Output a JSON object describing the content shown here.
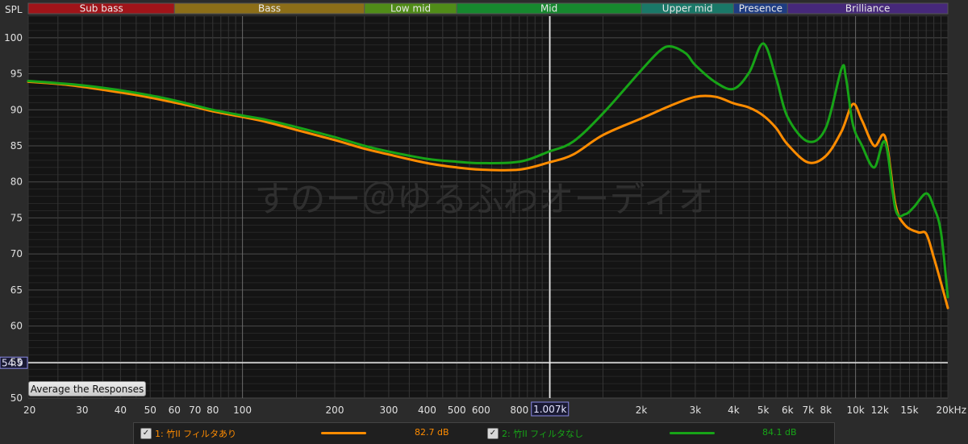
{
  "chart_data": {
    "type": "line",
    "ylabel": "SPL",
    "ylim": [
      50,
      103
    ],
    "xlim": [
      20,
      20000
    ],
    "xscale": "log",
    "grid": true,
    "yticks": [
      50,
      55,
      60,
      65,
      70,
      75,
      80,
      85,
      90,
      95,
      100
    ],
    "xticks": [
      {
        "v": 20,
        "label": "20"
      },
      {
        "v": 30,
        "label": "30"
      },
      {
        "v": 40,
        "label": "40"
      },
      {
        "v": 50,
        "label": "50"
      },
      {
        "v": 60,
        "label": "60"
      },
      {
        "v": 70,
        "label": "70"
      },
      {
        "v": 80,
        "label": "80"
      },
      {
        "v": 100,
        "label": "100"
      },
      {
        "v": 200,
        "label": "200"
      },
      {
        "v": 300,
        "label": "300"
      },
      {
        "v": 400,
        "label": "400"
      },
      {
        "v": 500,
        "label": "500"
      },
      {
        "v": 600,
        "label": "600"
      },
      {
        "v": 800,
        "label": "800"
      },
      {
        "v": 2000,
        "label": "2k"
      },
      {
        "v": 3000,
        "label": "3k"
      },
      {
        "v": 4000,
        "label": "4k"
      },
      {
        "v": 5000,
        "label": "5k"
      },
      {
        "v": 6000,
        "label": "6k"
      },
      {
        "v": 7000,
        "label": "7k"
      },
      {
        "v": 8000,
        "label": "8k"
      },
      {
        "v": 10000,
        "label": "10k"
      },
      {
        "v": 12000,
        "label": "12k"
      },
      {
        "v": 15000,
        "label": "15k"
      },
      {
        "v": 20000,
        "label": "20kHz"
      }
    ],
    "bands": [
      {
        "name": "Sub bass",
        "from": 20,
        "to": 60,
        "color": "#a01419"
      },
      {
        "name": "Bass",
        "from": 60,
        "to": 250,
        "color": "#8c6e18"
      },
      {
        "name": "Low mid",
        "from": 250,
        "to": 500,
        "color": "#508c18"
      },
      {
        "name": "Mid",
        "from": 500,
        "to": 2000,
        "color": "#16882e"
      },
      {
        "name": "Upper mid",
        "from": 2000,
        "to": 4000,
        "color": "#1a7868"
      },
      {
        "name": "Presence",
        "from": 4000,
        "to": 6000,
        "color": "#1e3c82"
      },
      {
        "name": "Brilliance",
        "from": 6000,
        "to": 20000,
        "color": "#46287a"
      }
    ],
    "cursor": {
      "x": 1007,
      "x_label": "1.007k",
      "y": 54.9,
      "y_label": "54.9"
    },
    "watermark": "すのー＠ゆるふわオーディオ",
    "series": [
      {
        "name": "1: 竹II フィルタあり",
        "color": "#ff8c00",
        "value_label": "82.7 dB",
        "x": [
          20,
          25,
          30,
          40,
          50,
          60,
          70,
          80,
          100,
          120,
          150,
          200,
          250,
          300,
          400,
          500,
          600,
          800,
          1000,
          1200,
          1500,
          2000,
          2500,
          3000,
          3500,
          4000,
          4500,
          5000,
          5500,
          6000,
          7000,
          8000,
          9000,
          9800,
          10500,
          11500,
          12500,
          13500,
          14500,
          16000,
          17000,
          18000,
          19000,
          20000
        ],
        "y": [
          93.9,
          93.6,
          93.2,
          92.4,
          91.7,
          91.0,
          90.4,
          89.8,
          89.0,
          88.3,
          87.2,
          85.8,
          84.6,
          83.8,
          82.6,
          82.0,
          81.7,
          81.7,
          82.7,
          83.8,
          86.5,
          88.8,
          90.6,
          91.8,
          91.8,
          90.9,
          90.3,
          89.2,
          87.5,
          85.2,
          82.7,
          83.6,
          87.0,
          90.8,
          88.5,
          85.0,
          86.2,
          76.8,
          74.0,
          73.0,
          72.8,
          69.5,
          66.0,
          62.5
        ]
      },
      {
        "name": "2: 竹II フィルタなし",
        "color": "#17a417",
        "value_label": "84.1 dB",
        "x": [
          20,
          25,
          30,
          40,
          50,
          60,
          70,
          80,
          100,
          120,
          150,
          200,
          250,
          300,
          400,
          500,
          600,
          800,
          1000,
          1200,
          1500,
          2000,
          2300,
          2500,
          2800,
          3000,
          3500,
          4000,
          4500,
          5000,
          5500,
          6000,
          7000,
          8000,
          9000,
          9300,
          9800,
          10500,
          11500,
          12500,
          13500,
          14500,
          15500,
          17000,
          18000,
          19000,
          20000
        ],
        "y": [
          94.0,
          93.7,
          93.4,
          92.7,
          92.0,
          91.3,
          90.6,
          90.0,
          89.2,
          88.6,
          87.6,
          86.2,
          85.0,
          84.2,
          83.2,
          82.8,
          82.6,
          82.8,
          84.2,
          85.6,
          89.5,
          95.5,
          98.2,
          98.8,
          97.8,
          96.2,
          93.8,
          92.9,
          95.2,
          99.2,
          94.5,
          89.0,
          85.6,
          87.5,
          95.7,
          94.5,
          88.0,
          85.0,
          82.0,
          85.5,
          76.2,
          75.5,
          76.5,
          78.4,
          76.5,
          73.0,
          64.0
        ]
      }
    ]
  },
  "controls": {
    "average_button": "Average the Responses"
  }
}
